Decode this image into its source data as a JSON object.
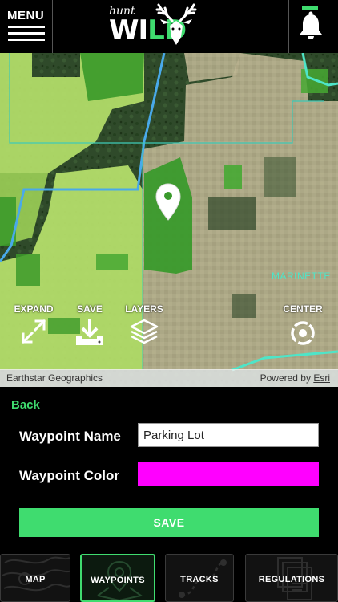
{
  "header": {
    "menu_label": "MENU",
    "logo_small": "hunt",
    "logo_wi": "WI",
    "logo_ld": "LD",
    "brand_green": "#3fdc6f"
  },
  "map": {
    "controls": {
      "expand": "EXPAND",
      "save": "SAVE",
      "layers": "LAYERS",
      "center": "CENTER"
    },
    "place_label": "MARINETTE",
    "attribution_left": "Earthstar Geographics",
    "attribution_powered": "Powered by",
    "attribution_link": "Esri",
    "marker_icon": "map-pin-icon"
  },
  "form": {
    "back": "Back",
    "waypoint_name_label": "Waypoint Name",
    "waypoint_name_value": "Parking Lot",
    "waypoint_color_label": "Waypoint Color",
    "waypoint_color_value": "#ff00ff",
    "save": "SAVE"
  },
  "tabs": [
    {
      "label": "MAP",
      "active": false
    },
    {
      "label": "WAYPOINTS",
      "active": true
    },
    {
      "label": "TRACKS",
      "active": false
    },
    {
      "label": "REGULATIONS",
      "active": false
    }
  ]
}
